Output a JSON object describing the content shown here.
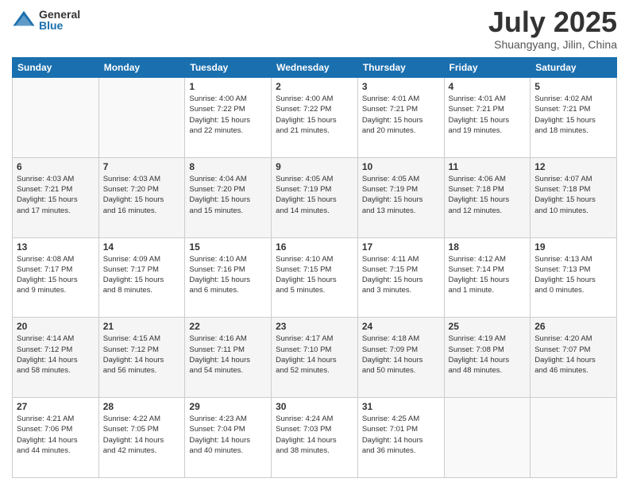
{
  "header": {
    "logo_general": "General",
    "logo_blue": "Blue",
    "month": "July 2025",
    "location": "Shuangyang, Jilin, China"
  },
  "weekdays": [
    "Sunday",
    "Monday",
    "Tuesday",
    "Wednesday",
    "Thursday",
    "Friday",
    "Saturday"
  ],
  "weeks": [
    [
      {
        "day": "",
        "info": ""
      },
      {
        "day": "",
        "info": ""
      },
      {
        "day": "1",
        "info": "Sunrise: 4:00 AM\nSunset: 7:22 PM\nDaylight: 15 hours\nand 22 minutes."
      },
      {
        "day": "2",
        "info": "Sunrise: 4:00 AM\nSunset: 7:22 PM\nDaylight: 15 hours\nand 21 minutes."
      },
      {
        "day": "3",
        "info": "Sunrise: 4:01 AM\nSunset: 7:21 PM\nDaylight: 15 hours\nand 20 minutes."
      },
      {
        "day": "4",
        "info": "Sunrise: 4:01 AM\nSunset: 7:21 PM\nDaylight: 15 hours\nand 19 minutes."
      },
      {
        "day": "5",
        "info": "Sunrise: 4:02 AM\nSunset: 7:21 PM\nDaylight: 15 hours\nand 18 minutes."
      }
    ],
    [
      {
        "day": "6",
        "info": "Sunrise: 4:03 AM\nSunset: 7:21 PM\nDaylight: 15 hours\nand 17 minutes."
      },
      {
        "day": "7",
        "info": "Sunrise: 4:03 AM\nSunset: 7:20 PM\nDaylight: 15 hours\nand 16 minutes."
      },
      {
        "day": "8",
        "info": "Sunrise: 4:04 AM\nSunset: 7:20 PM\nDaylight: 15 hours\nand 15 minutes."
      },
      {
        "day": "9",
        "info": "Sunrise: 4:05 AM\nSunset: 7:19 PM\nDaylight: 15 hours\nand 14 minutes."
      },
      {
        "day": "10",
        "info": "Sunrise: 4:05 AM\nSunset: 7:19 PM\nDaylight: 15 hours\nand 13 minutes."
      },
      {
        "day": "11",
        "info": "Sunrise: 4:06 AM\nSunset: 7:18 PM\nDaylight: 15 hours\nand 12 minutes."
      },
      {
        "day": "12",
        "info": "Sunrise: 4:07 AM\nSunset: 7:18 PM\nDaylight: 15 hours\nand 10 minutes."
      }
    ],
    [
      {
        "day": "13",
        "info": "Sunrise: 4:08 AM\nSunset: 7:17 PM\nDaylight: 15 hours\nand 9 minutes."
      },
      {
        "day": "14",
        "info": "Sunrise: 4:09 AM\nSunset: 7:17 PM\nDaylight: 15 hours\nand 8 minutes."
      },
      {
        "day": "15",
        "info": "Sunrise: 4:10 AM\nSunset: 7:16 PM\nDaylight: 15 hours\nand 6 minutes."
      },
      {
        "day": "16",
        "info": "Sunrise: 4:10 AM\nSunset: 7:15 PM\nDaylight: 15 hours\nand 5 minutes."
      },
      {
        "day": "17",
        "info": "Sunrise: 4:11 AM\nSunset: 7:15 PM\nDaylight: 15 hours\nand 3 minutes."
      },
      {
        "day": "18",
        "info": "Sunrise: 4:12 AM\nSunset: 7:14 PM\nDaylight: 15 hours\nand 1 minute."
      },
      {
        "day": "19",
        "info": "Sunrise: 4:13 AM\nSunset: 7:13 PM\nDaylight: 15 hours\nand 0 minutes."
      }
    ],
    [
      {
        "day": "20",
        "info": "Sunrise: 4:14 AM\nSunset: 7:12 PM\nDaylight: 14 hours\nand 58 minutes."
      },
      {
        "day": "21",
        "info": "Sunrise: 4:15 AM\nSunset: 7:12 PM\nDaylight: 14 hours\nand 56 minutes."
      },
      {
        "day": "22",
        "info": "Sunrise: 4:16 AM\nSunset: 7:11 PM\nDaylight: 14 hours\nand 54 minutes."
      },
      {
        "day": "23",
        "info": "Sunrise: 4:17 AM\nSunset: 7:10 PM\nDaylight: 14 hours\nand 52 minutes."
      },
      {
        "day": "24",
        "info": "Sunrise: 4:18 AM\nSunset: 7:09 PM\nDaylight: 14 hours\nand 50 minutes."
      },
      {
        "day": "25",
        "info": "Sunrise: 4:19 AM\nSunset: 7:08 PM\nDaylight: 14 hours\nand 48 minutes."
      },
      {
        "day": "26",
        "info": "Sunrise: 4:20 AM\nSunset: 7:07 PM\nDaylight: 14 hours\nand 46 minutes."
      }
    ],
    [
      {
        "day": "27",
        "info": "Sunrise: 4:21 AM\nSunset: 7:06 PM\nDaylight: 14 hours\nand 44 minutes."
      },
      {
        "day": "28",
        "info": "Sunrise: 4:22 AM\nSunset: 7:05 PM\nDaylight: 14 hours\nand 42 minutes."
      },
      {
        "day": "29",
        "info": "Sunrise: 4:23 AM\nSunset: 7:04 PM\nDaylight: 14 hours\nand 40 minutes."
      },
      {
        "day": "30",
        "info": "Sunrise: 4:24 AM\nSunset: 7:03 PM\nDaylight: 14 hours\nand 38 minutes."
      },
      {
        "day": "31",
        "info": "Sunrise: 4:25 AM\nSunset: 7:01 PM\nDaylight: 14 hours\nand 36 minutes."
      },
      {
        "day": "",
        "info": ""
      },
      {
        "day": "",
        "info": ""
      }
    ]
  ]
}
